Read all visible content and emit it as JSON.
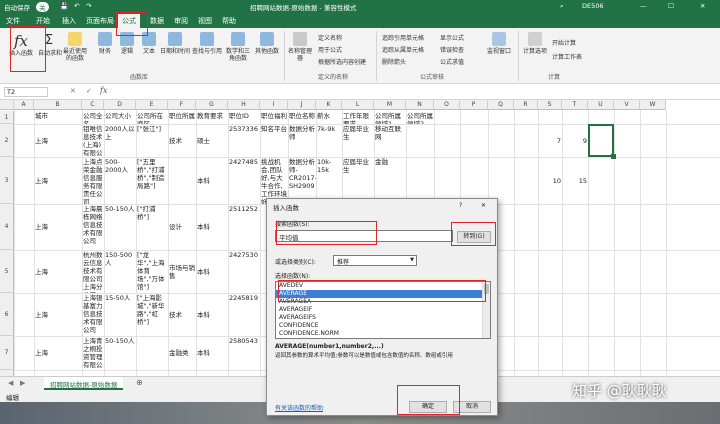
{
  "titlebar": {
    "autosave": "自动保存",
    "autosave_state": "关",
    "doc_title": "招聘网站数据-原始数据  -  兼容性模式",
    "user": "DE506"
  },
  "tabs": [
    "文件",
    "开始",
    "插入",
    "页面布局",
    "公式",
    "数据",
    "审阅",
    "视图",
    "帮助"
  ],
  "active_tab": "公式",
  "ribbon": {
    "insert_function": "插入函数",
    "autosum": "自动求和",
    "recent": "最近使用的函数",
    "financial": "财务",
    "logical": "逻辑",
    "text": "文本",
    "datetime": "日期和时间",
    "lookup": "查找与引用",
    "math": "数学和三角函数",
    "more": "其他函数",
    "group_library": "函数库",
    "name_manager": "名称管理器",
    "define_name": "定义名称",
    "use_in_formula": "用于公式",
    "create_from_sel": "根据所选内容创建",
    "group_names": "定义的名称",
    "trace_precedents": "追踪引用单元格",
    "trace_dependents": "追踪从属单元格",
    "remove_arrows": "删除箭头",
    "show_formulas": "显示公式",
    "error_checking": "错误检查",
    "evaluate": "公式求值",
    "group_audit": "公式审核",
    "watch": "监视窗口",
    "calc_options": "计算选项",
    "calc_now": "开始计算",
    "calc_sheet": "计算工作表",
    "group_calc": "计算"
  },
  "formula_bar": {
    "name_box": "T2",
    "fx": "fx",
    "content": ""
  },
  "columns": [
    "A",
    "B",
    "C",
    "D",
    "E",
    "F",
    "G",
    "H",
    "I",
    "J",
    "K",
    "L",
    "M",
    "N",
    "O",
    "P",
    "Q",
    "R",
    "S",
    "T",
    "U",
    "V",
    "W"
  ],
  "headers": [
    "城市",
    "公司全名",
    "公司大小",
    "公司所在商区",
    "职位所属",
    "教育要求",
    "职位ID",
    "职位福利",
    "职位名称",
    "薪水",
    "工作年限要求",
    "公司所属领域1",
    "公司所属领域2"
  ],
  "rows": [
    {
      "num": "2",
      "cells": [
        "上海",
        "钼唯信息技术(上海)有限公司",
        "2000人以上",
        "[\"张江\"]",
        "技术",
        "硕士",
        "2537336",
        "知名平台",
        "数据分析师",
        "7k-9k",
        "应届毕业生",
        "移动互联网",
        ""
      ],
      "r": "7",
      "s": "9"
    },
    {
      "num": "3",
      "cells": [
        "上海",
        "上海点荣金融信息服务有限责任公司",
        "500-2000人",
        "[\"五里桥\",\"打浦桥\",\"制造局路\"]",
        "",
        "本科",
        "2427485",
        "挑战机会,团队好,与大牛合作,工作环境好",
        "数据分析师-CR2017-SH2909",
        "10k-15k",
        "应届毕业生",
        "金融",
        ""
      ],
      "r": "10",
      "s": "15"
    },
    {
      "num": "4",
      "cells": [
        "上海",
        "上海晨栋网络信息技术有限公司",
        "50-150人",
        "[\"打浦桥\"]",
        "设计",
        "本科",
        "2511252",
        "",
        "",
        "",
        "",
        "",
        ""
      ],
      "r": "",
      "s": ""
    },
    {
      "num": "5",
      "cells": [
        "上海",
        "杭州数云信息技术有限公司上海分公司",
        "150-500人",
        "[\"龙华\",\"上海体育场\",\"万体馆\"]",
        "市场与销售",
        "本科",
        "2427530",
        "",
        "",
        "",
        "",
        "",
        ""
      ],
      "r": "",
      "s": ""
    },
    {
      "num": "6",
      "cells": [
        "上海",
        "上海银基富力信息技术有限公司",
        "15-50人",
        "[\"上海影城\",\"新华路\",\"虹桥\"]",
        "技术",
        "本科",
        "2245819",
        "",
        "",
        "",
        "",
        "",
        ""
      ],
      "r": "",
      "s": ""
    },
    {
      "num": "7",
      "cells": [
        "上海",
        "上海青之桐投资管理有限公司",
        "50-150人",
        "",
        "金融类",
        "本科",
        "2580543",
        "",
        "",
        "",
        "",
        "",
        ""
      ],
      "r": "",
      "s": ""
    }
  ],
  "sheet_tab": "招聘网站数据-原始数据",
  "status": "编辑",
  "watermark": "知乎 @耿耿耿",
  "dialog": {
    "title": "插入函数",
    "help_btn": "?",
    "close_btn": "✕",
    "search_label": "搜索函数(S):",
    "search_value": "平均值",
    "goto_btn": "转到(G)",
    "category_label": "或选择类别(C):",
    "category_value": "推荐",
    "select_label": "选择函数(N):",
    "functions": [
      "AVEDEV",
      "AVERAGE",
      "AVERAGEA",
      "AVERAGEIF",
      "AVERAGEIFS",
      "CONFIDENCE",
      "CONFIDENCE.NORM"
    ],
    "selected_function": "AVERAGE",
    "signature": "AVERAGE(number1,number2,...)",
    "description": "返回其参数的算术平均值;参数可以是数值或包含数值的名称、数组或引用",
    "help_link": "有关该函数的帮助",
    "ok_btn": "确定",
    "cancel_btn": "取消"
  },
  "colors": {
    "excel_green": "#217346",
    "highlight_red": "#e0242b",
    "selection_blue": "#3c7dd6"
  }
}
